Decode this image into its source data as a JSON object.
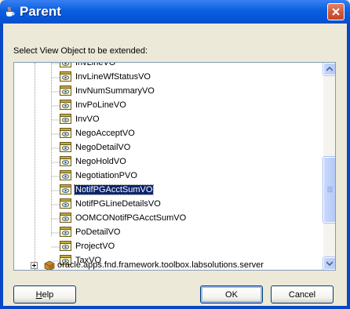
{
  "window": {
    "title": "Parent",
    "prompt": "Select View Object to be extended:"
  },
  "tree": {
    "items": [
      {
        "label": "InvLineVO",
        "selected": false
      },
      {
        "label": "InvLineWfStatusVO",
        "selected": false
      },
      {
        "label": "InvNumSummaryVO",
        "selected": false
      },
      {
        "label": "InvPoLineVO",
        "selected": false
      },
      {
        "label": "InvVO",
        "selected": false
      },
      {
        "label": "NegoAcceptVO",
        "selected": false
      },
      {
        "label": "NegoDetailVO",
        "selected": false
      },
      {
        "label": "NegoHoldVO",
        "selected": false
      },
      {
        "label": "NegotiationPVO",
        "selected": false
      },
      {
        "label": "NotifPGAcctSumVO",
        "selected": true
      },
      {
        "label": "NotifPGLineDetailsVO",
        "selected": false
      },
      {
        "label": "OOMCONotifPGAcctSumVO",
        "selected": false
      },
      {
        "label": "PoDetailVO",
        "selected": false
      },
      {
        "label": "ProjectVO",
        "selected": false
      },
      {
        "label": "TaxVO",
        "selected": false
      }
    ],
    "package": {
      "label": "oracle.apps.fnd.framework.toolbox.labsolutions.server"
    }
  },
  "buttons": {
    "help_prefix": "H",
    "help_rest": "elp",
    "ok": "OK",
    "cancel": "Cancel"
  },
  "colors": {
    "title_bar": "#0A5FE0",
    "selection": "#0A246A",
    "dialog_bg": "#ECE9D8"
  }
}
